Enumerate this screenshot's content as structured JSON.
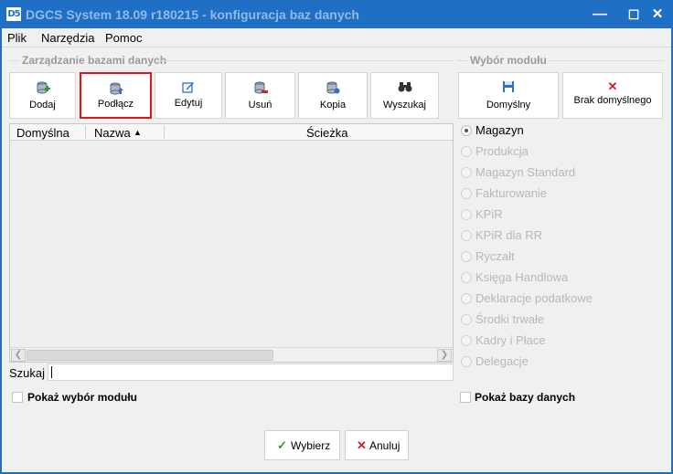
{
  "window": {
    "logo": "D5",
    "title": "DGCS System 18.09 r180215 - konfiguracja baz danych",
    "minimize_glyph": "—",
    "maximize_glyph": "☐",
    "close_glyph": "✕"
  },
  "menu": {
    "items": [
      "Plik",
      "Narzędzia",
      "Pomoc"
    ]
  },
  "db_group": {
    "label": "Zarządzanie bazami danych",
    "buttons": [
      {
        "label": "Dodaj",
        "icon": "database-add-icon"
      },
      {
        "label": "Podłącz",
        "icon": "database-connect-icon",
        "selected": true
      },
      {
        "label": "Edytuj",
        "icon": "edit-icon"
      },
      {
        "label": "Usuń",
        "icon": "database-remove-icon"
      },
      {
        "label": "Kopia",
        "icon": "database-copy-icon"
      },
      {
        "label": "Wyszukaj",
        "icon": "binoculars-icon"
      }
    ]
  },
  "grid": {
    "columns": [
      "Domyślna",
      "Nazwa",
      "Ścieżka"
    ],
    "sort_indicator": "▲",
    "rows": []
  },
  "search": {
    "label": "Szukaj",
    "value": ""
  },
  "show_module_checkbox": {
    "label": "Pokaż wybór modułu",
    "checked": false
  },
  "module_group": {
    "label": "Wybór modułu",
    "default_button": {
      "label": "Domyślny",
      "icon": "save-icon"
    },
    "no_default_button": {
      "label": "Brak domyślnego",
      "icon": "close-red-icon",
      "glyph": "✕"
    },
    "modules": [
      {
        "label": "Magazyn",
        "selected": true,
        "enabled": true
      },
      {
        "label": "Produkcja",
        "selected": false,
        "enabled": false
      },
      {
        "label": "Magazyn Standard",
        "selected": false,
        "enabled": false
      },
      {
        "label": "Fakturowanie",
        "selected": false,
        "enabled": false
      },
      {
        "label": "KPiR",
        "selected": false,
        "enabled": false
      },
      {
        "label": "KPiR dla RR",
        "selected": false,
        "enabled": false
      },
      {
        "label": "Ryczałt",
        "selected": false,
        "enabled": false
      },
      {
        "label": "Księga Handlowa",
        "selected": false,
        "enabled": false
      },
      {
        "label": "Deklaracje podatkowe",
        "selected": false,
        "enabled": false
      },
      {
        "label": "Środki trwałe",
        "selected": false,
        "enabled": false
      },
      {
        "label": "Kadry i Płace",
        "selected": false,
        "enabled": false
      },
      {
        "label": "Delegacje",
        "selected": false,
        "enabled": false
      }
    ]
  },
  "show_db_checkbox": {
    "label": "Pokaż bazy danych",
    "checked": false
  },
  "footer": {
    "ok": {
      "label": "Wybierz",
      "glyph": "✓",
      "color": "#2e9b2e"
    },
    "cancel": {
      "label": "Anuluj",
      "glyph": "✕",
      "color": "#d0202a"
    }
  },
  "colors": {
    "titlebar": "#1f6fc5",
    "selection_outline": "#e0141c"
  }
}
